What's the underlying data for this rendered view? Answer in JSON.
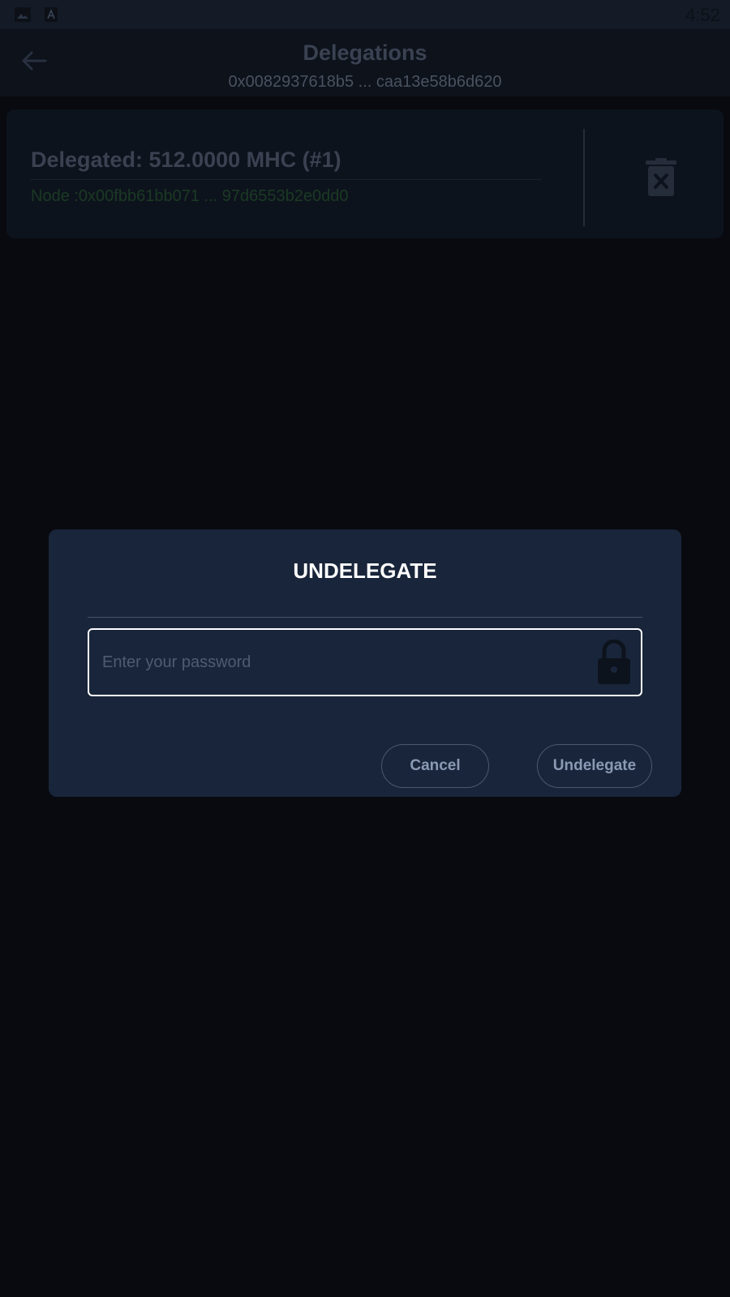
{
  "status_bar": {
    "time": "4:52",
    "icons": [
      "image-icon",
      "a-letter-icon"
    ]
  },
  "header": {
    "title": "Delegations",
    "subtitle": "0x0082937618b5 ... caa13e58b6d620",
    "back_icon": "arrow-back-icon"
  },
  "delegation": {
    "amount": "Delegated: 512.0000 MHC (#1)",
    "node": "Node :0x00fbb61bb071 ... 97d6553b2e0dd0",
    "delete_icon": "trash-delete-icon"
  },
  "dialog": {
    "title": "UNDELEGATE",
    "password_placeholder": "Enter your password",
    "password_value": "",
    "lock_icon": "lock-icon",
    "cancel_label": "Cancel",
    "confirm_label": "Undelegate"
  },
  "colors": {
    "background": "#080a0f",
    "dialog_bg": "#19253a",
    "node_text": "#1b3a24",
    "button_text": "#8a9ab4"
  }
}
